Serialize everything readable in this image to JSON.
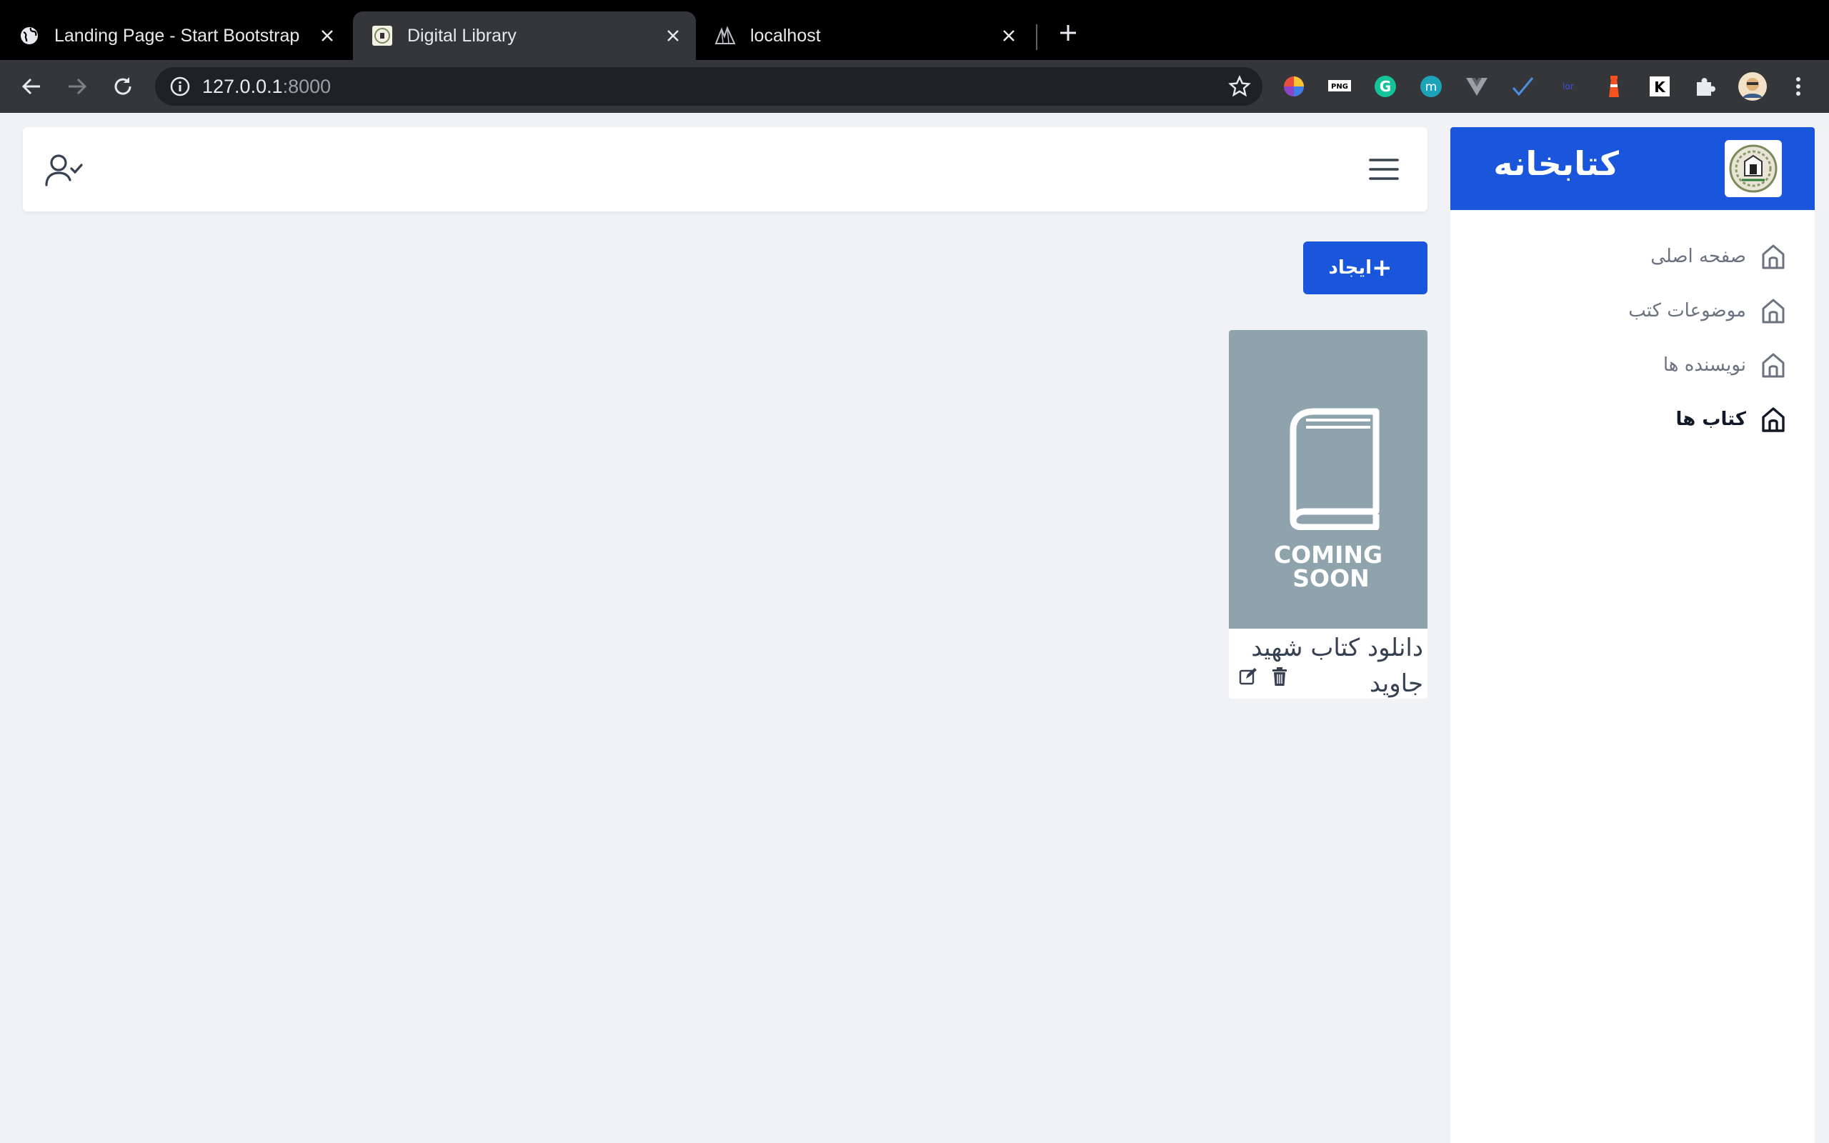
{
  "browser": {
    "tabs": [
      {
        "title": "Landing Page - Start Bootstrap",
        "active": false,
        "favicon": "globe-icon"
      },
      {
        "title": "Digital Library",
        "active": true,
        "favicon": "seal-icon"
      },
      {
        "title": "localhost",
        "active": false,
        "favicon": "mountain-icon"
      }
    ],
    "url": {
      "host": "127.0.0.1",
      "port": ":8000"
    },
    "extensions": [
      "color-wheel-icon",
      "pdf-icon",
      "grammarly-icon",
      "m-icon",
      "vue-icon",
      "check-icon",
      "lorem-icon",
      "lighthouse-icon",
      "k-icon",
      "puzzle-icon",
      "profile-avatar"
    ]
  },
  "header": {
    "user_icon": "user-check-icon",
    "menu_icon": "hamburger-icon"
  },
  "actions": {
    "create_label": "ایجاد",
    "create_icon": "plus"
  },
  "books": [
    {
      "title": "دانلود کتاب شهید جاوید",
      "cover_text_line1": "COMING",
      "cover_text_line2": "SOON"
    }
  ],
  "sidebar": {
    "brand": "کتابخانه",
    "items": [
      {
        "label": "صفحه اصلی",
        "active": false
      },
      {
        "label": "موضوعات کتب",
        "active": false
      },
      {
        "label": "نویسنده ها",
        "active": false
      },
      {
        "label": "کتاب ها",
        "active": true
      }
    ]
  },
  "colors": {
    "primary": "#1a56db",
    "page_bg": "#f0f2f5",
    "cover_bg": "#8fa3ad"
  }
}
